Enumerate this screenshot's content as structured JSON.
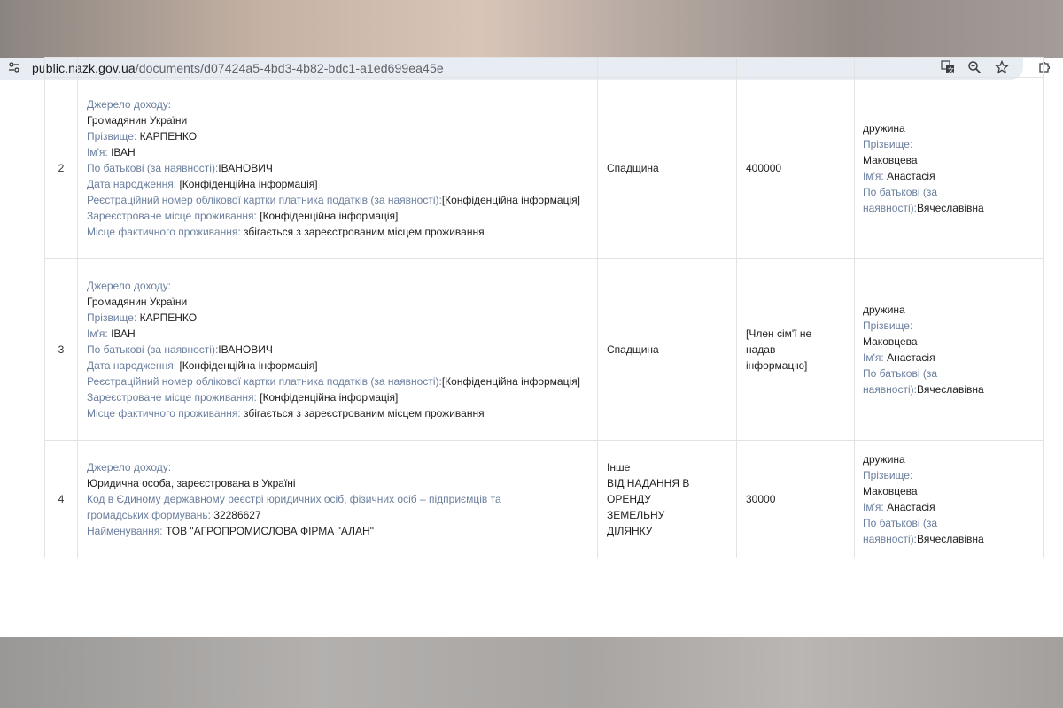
{
  "browser": {
    "url_host": "public.nazk.gov.ua",
    "url_path": "/documents/d07424a5-4bd3-4b82-bdc1-a1ed699ea45e",
    "icons": [
      "tune-icon",
      "translate-icon",
      "zoom-icon",
      "star-icon",
      "extensions-icon"
    ]
  },
  "labels": {
    "source": "Джерело доходу:",
    "surname": "Прізвище:",
    "name": "Ім'я:",
    "patronymic": "По батькові (за наявності):",
    "birthdate": "Дата народження:",
    "tax_number": "Реєстраційний номер облікової картки платника податків (за наявності):",
    "reg_address": "Зареєстроване місце проживання:",
    "actual_address": "Місце фактичного проживання:",
    "edrpou": "Код в Єдиному державному реєстрі юридичних осіб, фізичних осіб – підприємців та громадських формувань:",
    "entity_name": "Найменування:",
    "member_surname": "Прізвище:",
    "member_name": "Ім'я:",
    "member_patronymic": "По батькові (за наявності):"
  },
  "rows": [
    {
      "num": "2",
      "source_type": "Громадянин України",
      "surname": "КАРПЕНКО",
      "name": "ІВАН",
      "patronymic": "ІВАНОВИЧ",
      "birthdate": "[Конфіденційна інформація]",
      "tax_number": "[Конфіденційна інформація]",
      "reg_address": "[Конфіденційна інформація]",
      "actual_address": "збігається з зареєстрованим місцем проживання",
      "income_type": "Спадщина",
      "amount": "400000",
      "member_role": "дружина",
      "member_surname": "Маковцева",
      "member_name": "Анастасія",
      "member_patronymic": "Вячеславівна"
    },
    {
      "num": "3",
      "source_type": "Громадянин України",
      "surname": "КАРПЕНКО",
      "name": "ІВАН",
      "patronymic": "ІВАНОВИЧ",
      "birthdate": "[Конфіденційна інформація]",
      "tax_number": "[Конфіденційна інформація]",
      "reg_address": "[Конфіденційна інформація]",
      "actual_address": "збігається з зареєстрованим місцем проживання",
      "income_type": "Спадщина",
      "amount": "[Член сім'ї не надав інформацію]",
      "member_role": "дружина",
      "member_surname": "Маковцева",
      "member_name": "Анастасія",
      "member_patronymic": "Вячеславівна"
    },
    {
      "num": "4",
      "source_type": "Юридична особа, зареєстрована в Україні",
      "edrpou": "32286627",
      "entity_name": "ТОВ \"АГРОПРОМИСЛОВА ФІРМА \"АЛАН\"",
      "income_type": "Інше",
      "income_detail": "ВІД НАДАННЯ В ОРЕНДУ ЗЕМЕЛЬНУ ДІЛЯНКУ",
      "amount": "30000",
      "member_role": "дружина",
      "member_surname": "Маковцева",
      "member_name": "Анастасія",
      "member_patronymic": "Вячеславівна"
    }
  ]
}
